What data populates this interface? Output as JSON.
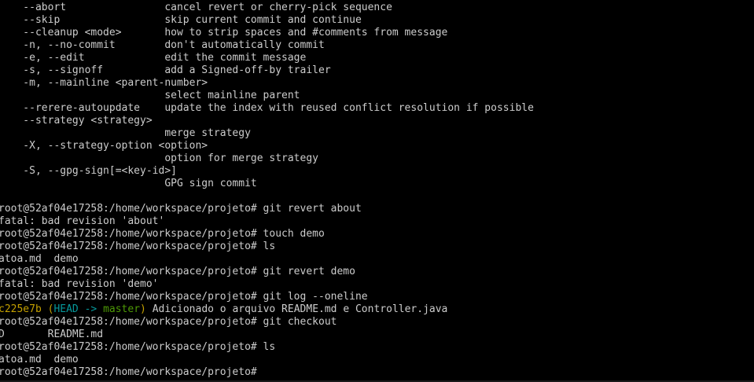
{
  "terminal": {
    "lines": [
      "    --abort                cancel revert or cherry-pick sequence",
      "    --skip                 skip current commit and continue",
      "    --cleanup <mode>       how to strip spaces and #comments from message",
      "    -n, --no-commit        don't automatically commit",
      "    -e, --edit             edit the commit message",
      "    -s, --signoff          add a Signed-off-by trailer",
      "    -m, --mainline <parent-number>",
      "                           select mainline parent",
      "    --rerere-autoupdate    update the index with reused conflict resolution if possible",
      "    --strategy <strategy>",
      "                           merge strategy",
      "    -X, --strategy-option <option>",
      "                           option for merge strategy",
      "    -S, --gpg-sign[=<key-id>]",
      "                           GPG sign commit",
      "",
      "root@52af04e17258:/home/workspace/projeto# git revert about",
      "fatal: bad revision 'about'",
      "root@52af04e17258:/home/workspace/projeto# touch demo",
      "root@52af04e17258:/home/workspace/projeto# ls",
      "atoa.md  demo",
      "root@52af04e17258:/home/workspace/projeto# git revert demo",
      "fatal: bad revision 'demo'",
      "root@52af04e17258:/home/workspace/projeto# git log --oneline"
    ],
    "log_line": {
      "hash": "c225e7b",
      "paren_open": " (",
      "head": "HEAD -> ",
      "branch": "master",
      "paren_close": ")",
      "message": " Adicionado o arquivo README.md e Controller.java"
    },
    "lines_after": [
      "root@52af04e17258:/home/workspace/projeto# git checkout",
      "D       README.md",
      "root@52af04e17258:/home/workspace/projeto# ls",
      "atoa.md  demo",
      "root@52af04e17258:/home/workspace/projeto#"
    ]
  }
}
